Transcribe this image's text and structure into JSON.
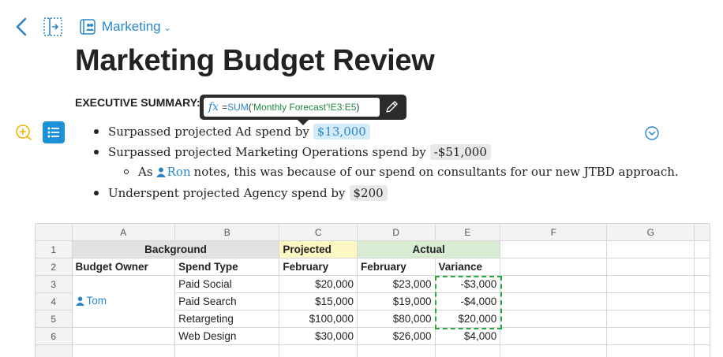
{
  "nav": {
    "folder_label": "Marketing"
  },
  "document": {
    "title": "Marketing Budget Review",
    "exec_summary_label": "EXECUTIVE SUMMARY:"
  },
  "formula_tooltip": {
    "fx_symbol": "fx",
    "equals": "=",
    "function_name": "SUM",
    "open_paren": "(",
    "argument": "'Monthly Forecast'!E3:E5",
    "close_paren": ")"
  },
  "bullets": [
    {
      "text": "Surpassed projected Ad spend by",
      "value": "$13,000"
    },
    {
      "text": "Surpassed projected Marketing Operations spend by",
      "value": "-$51,000"
    },
    {
      "prefix": "As",
      "mention": "Ron",
      "suffix": "notes, this was because of our spend on consultants for our new JTBD approach."
    },
    {
      "text": "Underspent projected Agency spend by",
      "value": "$200"
    }
  ],
  "sheet": {
    "columns": [
      "A",
      "B",
      "C",
      "D",
      "E",
      "F",
      "G"
    ],
    "row1": {
      "background": "Background",
      "projected": "Projected",
      "actual": "Actual"
    },
    "row2": {
      "a": "Budget Owner",
      "b": "Spend Type",
      "c": "February",
      "d": "February",
      "e": "Variance"
    },
    "rows": [
      {
        "num": "3",
        "owner": "",
        "spend": "Paid Social",
        "proj": "$20,000",
        "act": "$23,000",
        "var": "-$3,000"
      },
      {
        "num": "4",
        "owner": "Tom",
        "spend": "Paid Search",
        "proj": "$15,000",
        "act": "$19,000",
        "var": "-$4,000"
      },
      {
        "num": "5",
        "owner": "",
        "spend": "Retargeting",
        "proj": "$100,000",
        "act": "$80,000",
        "var": "$20,000"
      },
      {
        "num": "6",
        "owner": "",
        "spend": "Web Design",
        "proj": "$30,000",
        "act": "$26,000",
        "var": "$4,000"
      }
    ],
    "row1_num": "1",
    "row2_num": "2"
  },
  "colors": {
    "accent": "#2a86c9",
    "projected_fill": "#fdf7c3",
    "actual_fill": "#d8ecd4",
    "selection": "#28a745"
  }
}
